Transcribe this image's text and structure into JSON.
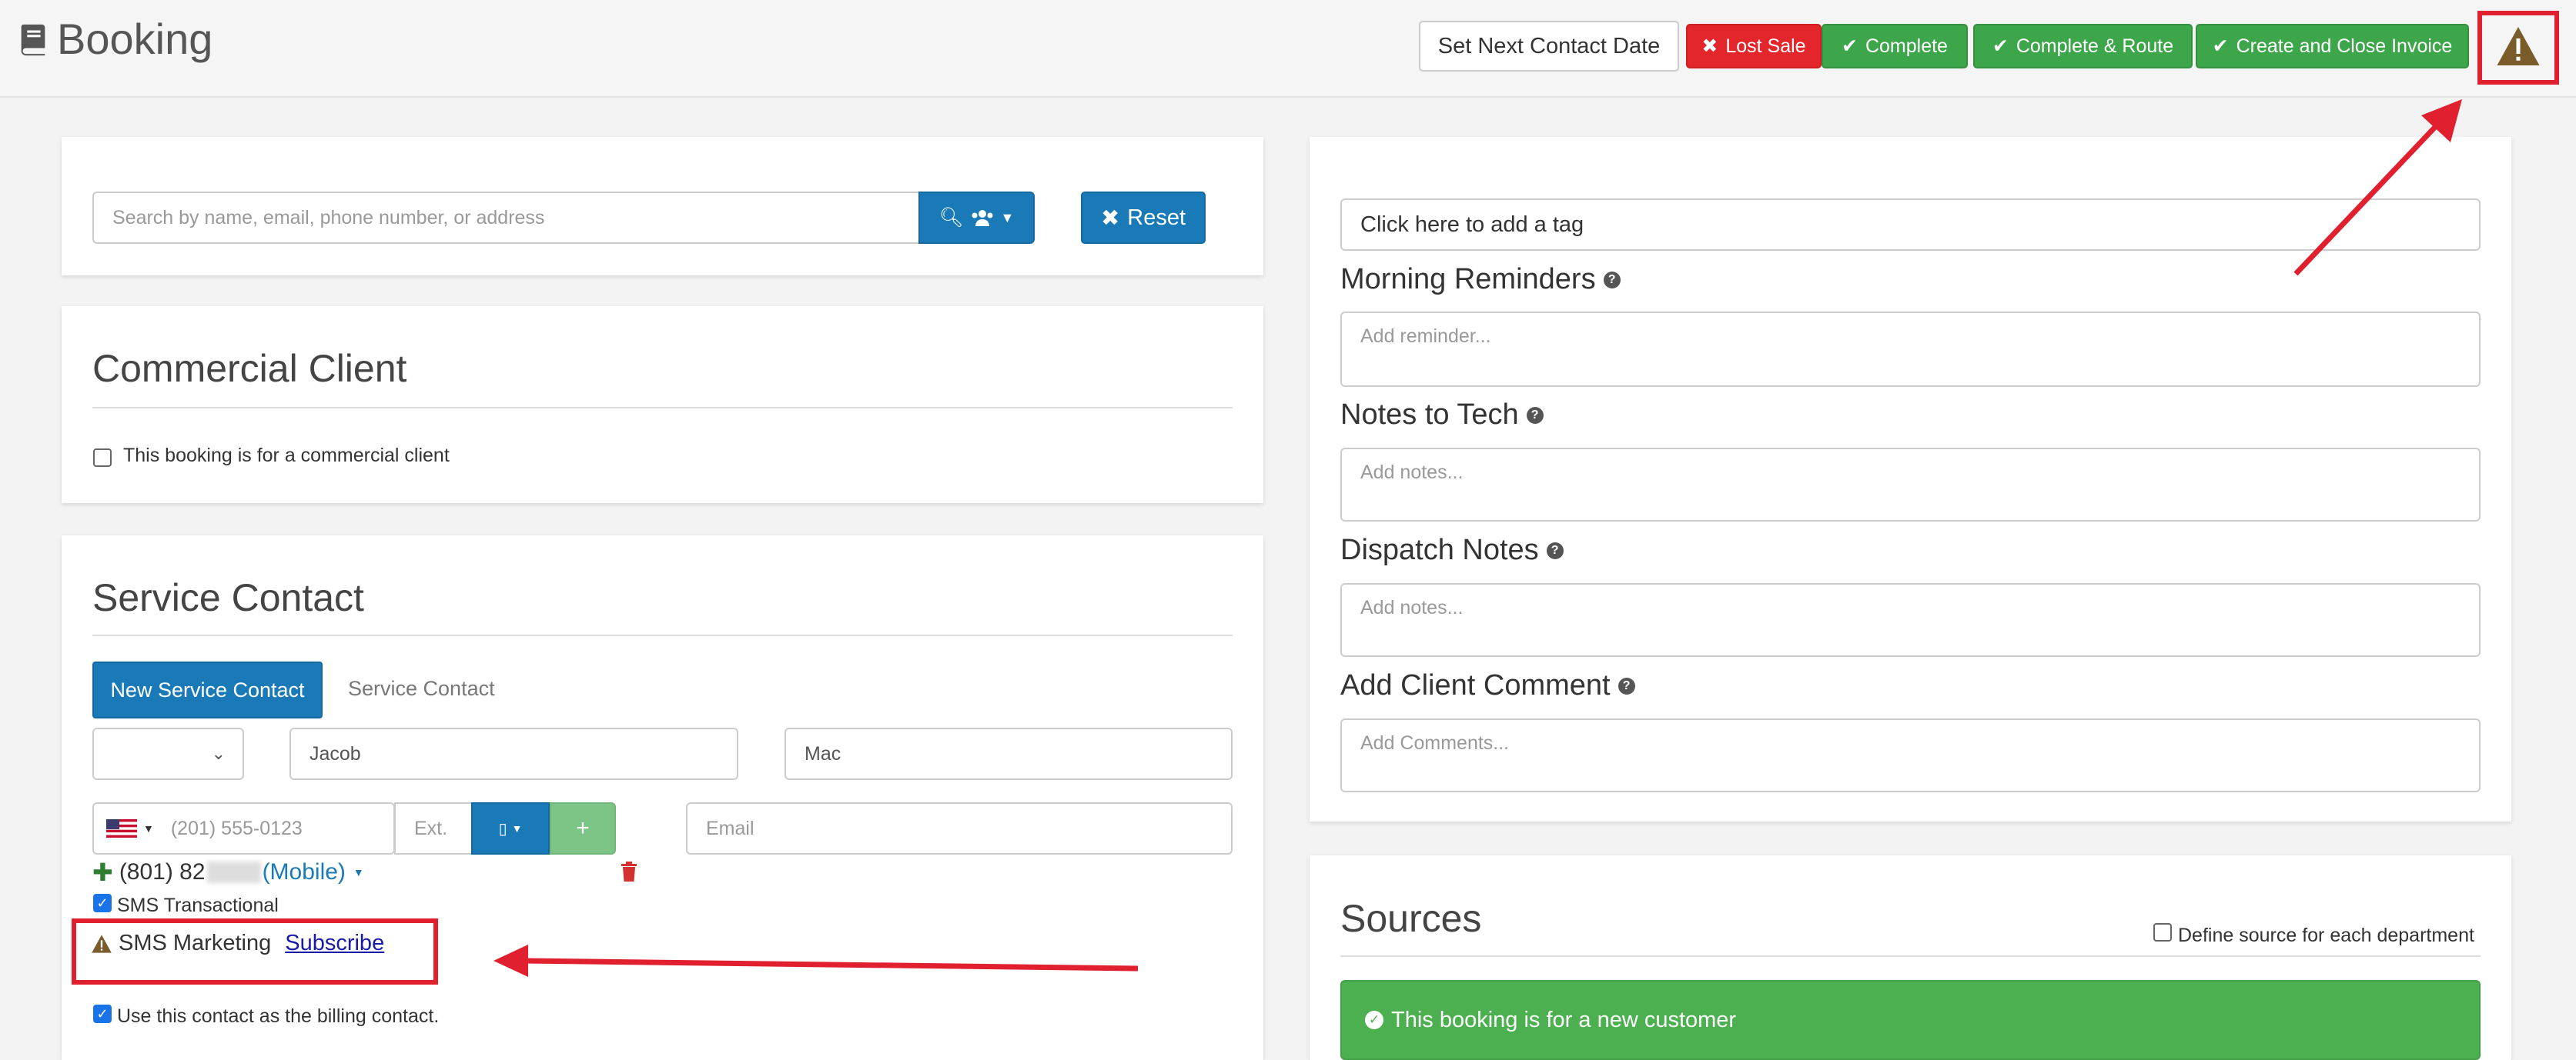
{
  "header": {
    "title": "Booking",
    "buttons": {
      "set_next_contact": "Set Next Contact Date",
      "lost_sale": "Lost Sale",
      "complete": "Complete",
      "complete_route": "Complete & Route",
      "create_close_invoice": "Create and Close Invoice"
    }
  },
  "search": {
    "placeholder": "Search by name, email, phone number, or address",
    "reset_label": "Reset"
  },
  "commercial": {
    "title": "Commercial Client",
    "checkbox_label": "This booking is for a commercial client"
  },
  "service_contact": {
    "title": "Service Contact",
    "tabs": [
      "New Service Contact",
      "Service Contact"
    ],
    "first_name": "Jacob",
    "last_name": "Mac",
    "phone_placeholder": "(201) 555-0123",
    "ext_placeholder": "Ext.",
    "email_placeholder": "Email",
    "phone_number": "(801) 82",
    "phone_type": "(Mobile)",
    "sms_transactional": "SMS Transactional",
    "sms_marketing": "SMS Marketing",
    "subscribe": "Subscribe",
    "billing_label": "Use this contact as the billing contact."
  },
  "right": {
    "tag_placeholder": "Click here to add a tag",
    "morning_reminders": "Morning Reminders",
    "reminder_placeholder": "Add reminder...",
    "notes_to_tech": "Notes to Tech",
    "notes_placeholder": "Add notes...",
    "dispatch_notes": "Dispatch Notes",
    "dispatch_placeholder": "Add notes...",
    "client_comment": "Add Client Comment",
    "comment_placeholder": "Add Comments..."
  },
  "sources": {
    "title": "Sources",
    "define_label": "Define source for each department",
    "new_customer": "This booking is for a new customer"
  },
  "colors": {
    "primary": "#1a7ab8",
    "success": "#3ea64a",
    "danger": "#e3262b",
    "annotation": "#e0202e"
  }
}
